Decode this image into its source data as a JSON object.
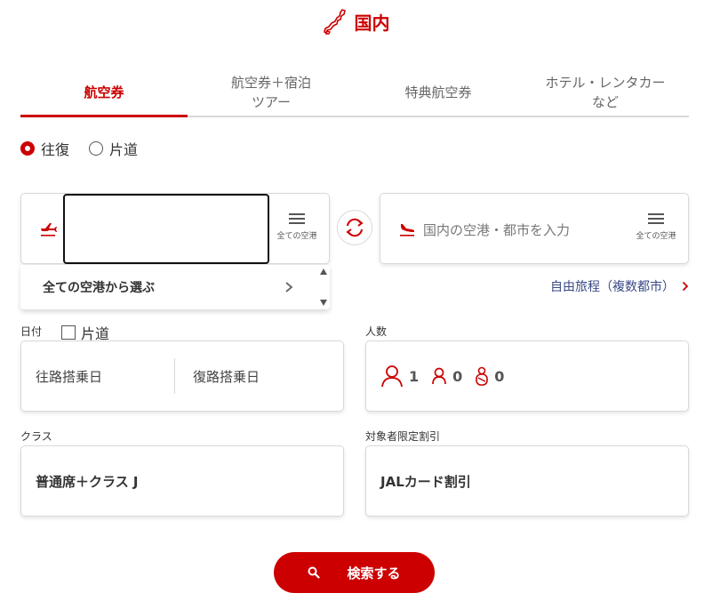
{
  "header": {
    "title": "国内",
    "icon": "japan-map-icon"
  },
  "tabs": [
    {
      "label": "航空券",
      "active": true
    },
    {
      "label": "航空券＋宿泊\nツアー",
      "active": false
    },
    {
      "label": "特典航空券",
      "active": false
    },
    {
      "label": "ホテル・レンタカー\nなど",
      "active": false
    }
  ],
  "trip_type": {
    "round_trip": "往復",
    "one_way": "片道",
    "selected": "round_trip"
  },
  "origin": {
    "value": "",
    "list_caption": "全ての空港"
  },
  "destination": {
    "placeholder": "国内の空港・都市を入力",
    "list_caption": "全ての空港"
  },
  "dropdown": {
    "item": "全ての空港から選ぶ"
  },
  "free_trip": {
    "label": "自由旅程（複数都市）"
  },
  "dates": {
    "label": "日付",
    "one_way_check": "片道",
    "outbound_placeholder": "往路搭乗日",
    "return_placeholder": "復路搭乗日"
  },
  "passengers": {
    "label": "人数",
    "adults": "1",
    "children": "0",
    "infants": "0"
  },
  "class_field": {
    "label": "クラス",
    "value": "普通席＋クラス J"
  },
  "discount": {
    "label": "対象者限定割引",
    "value": "JALカード割引"
  },
  "search": {
    "label": "検索する"
  },
  "colors": {
    "accent": "#cc0000",
    "link": "#3a4a86",
    "border": "#d9d9d9"
  }
}
